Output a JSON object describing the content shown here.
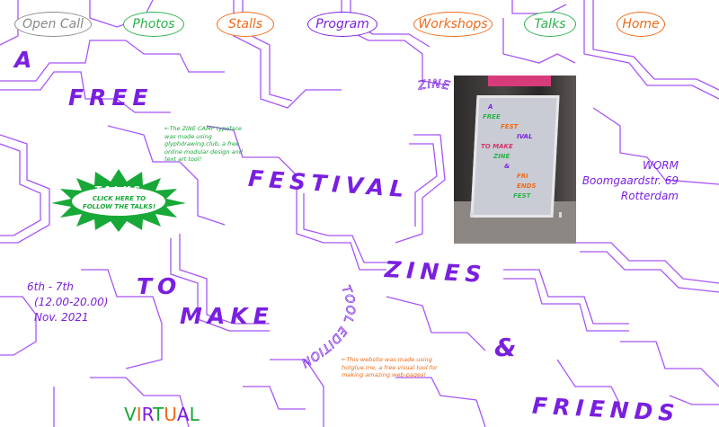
{
  "nav": [
    {
      "label": "Open Call",
      "color": "#8a8a8a"
    },
    {
      "label": "Photos",
      "color": "#2bb24c"
    },
    {
      "label": "Stalls",
      "color": "#ef6a17"
    },
    {
      "label": "Program",
      "color": "#7a1fe0"
    },
    {
      "label": "Workshops",
      "color": "#ef6a17"
    },
    {
      "label": "Talks",
      "color": "#2bb24c"
    },
    {
      "label": "Home",
      "color": "#ef6a17"
    }
  ],
  "headline": {
    "a": "A",
    "free": "FREE",
    "festival": "FESTIVAL",
    "to": "TO",
    "make": "MAKE",
    "zines": "ZINES",
    "and": "&",
    "friends": "FRIENDS"
  },
  "typeface_note": "←The ZINE CAMP typeface was made using glyphdrawing.club, a free online modular design and text art tool!",
  "hotglue_note": "←This website was made using hotglue.me, a free visual tool for making amazing web-pages!",
  "talks_badge": {
    "title": "TALKS",
    "line1": "CLICK HERE TO",
    "line2": "FOLLOW THE TALKS!",
    "color": "#18a838"
  },
  "dates": {
    "line1": "6th - 7th",
    "line2": "(12.00-20.00)",
    "line3": "Nov. 2021"
  },
  "location": {
    "line1": "WORM",
    "line2": "Boomgaardstr. 69",
    "line3": "Rotterdam"
  },
  "zine_camp_arc": "ZINE CAMP",
  "tool_edition_arc": "TOOL EDITION",
  "virtual": [
    "V",
    "I",
    "R",
    "T",
    "U",
    "A",
    "L"
  ],
  "virtual_colors": [
    "#18a838",
    "#ef6a17",
    "#7a1fe0",
    "#18a838",
    "#ef6a17",
    "#7a1fe0",
    "#18a838"
  ],
  "poster_words": [
    "A",
    "FREE",
    "FEST",
    "IVAL",
    "TO MAKE",
    "ZINE",
    "&",
    "FRI ENDS",
    "FEST"
  ],
  "colors": {
    "purple": "#7a1fe0",
    "orange": "#ef6a17",
    "green": "#18a838",
    "grey": "#8a8a8a"
  }
}
